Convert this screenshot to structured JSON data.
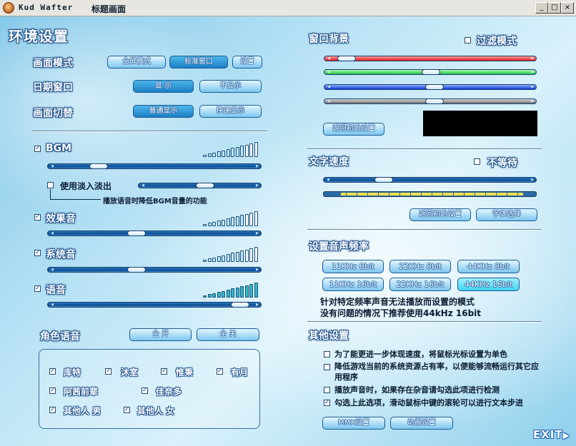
{
  "window": {
    "app_name": "Kud Wafter",
    "title": "标题画面",
    "controls": [
      "_",
      "□",
      "×"
    ]
  },
  "screen_title": "环境设置",
  "left": {
    "display_mode": {
      "label": "画面模式",
      "buttons": [
        "全屏模式",
        "标准窗口",
        "设置"
      ],
      "active": "标准窗口"
    },
    "date_window": {
      "label": "日期窗口",
      "buttons": [
        "显 示",
        "不显示"
      ],
      "active": "显 示"
    },
    "screen_switch": {
      "label": "画面切替",
      "buttons": [
        "普通显示",
        "快速显示"
      ],
      "active": "普通显示"
    },
    "bgm": {
      "label": "BGM",
      "checked": true,
      "level": 0.2,
      "volume_level": 0.75
    },
    "fade": {
      "label": "使用淡入淡出",
      "checked": false,
      "level": 0.55,
      "note": "播放语音时降低BGM音量的功能"
    },
    "sfx": {
      "label": "效果音",
      "checked": true,
      "level": 0.4,
      "volume_level": 0.75
    },
    "system": {
      "label": "系统音",
      "checked": true,
      "level": 0.4,
      "volume_level": 0.75
    },
    "voice": {
      "label": "语音",
      "checked": true,
      "level": 0.95,
      "volume_level": 1.0
    },
    "character_voice": {
      "label": "角色语音",
      "buttons": [
        "全 开",
        "全 关"
      ],
      "characters": [
        "库特",
        "沐室",
        "惟秉",
        "有月",
        "阿茜前辈",
        "佳奈多",
        "其他人 男",
        "其他人 女"
      ]
    }
  },
  "right": {
    "window_bg": {
      "label": "窗口背景",
      "filter_mode": {
        "label": "过滤模式",
        "checked": false
      },
      "sliders": [
        {
          "name": "red",
          "level": 0.05
        },
        {
          "name": "green",
          "level": 0.5
        },
        {
          "name": "blue",
          "level": 0.52
        },
        {
          "name": "alpha",
          "level": 0.52
        }
      ],
      "reset": "返回初始设置",
      "preview_color": "#000000"
    },
    "text_speed": {
      "label": "文字速度",
      "no_wait": {
        "label": "不等待",
        "checked": false
      },
      "level": 0.25,
      "reset": "返回初始设置",
      "font": "字体选择"
    },
    "sound_freq": {
      "label": "设置音声频率",
      "options": [
        "11KHz 8bit",
        "22KHz 8bit",
        "44KHz 8bit",
        "11KHz 16bit",
        "22KHz 16bit",
        "44KHz 16bit"
      ],
      "selected": "44KHz 16bit",
      "note_1": "针对特定频率声音无法播放而设置的模式",
      "note_2": "没有问题的情况下推荐使用44kHz 16bit"
    },
    "other": {
      "label": "其他设置",
      "options": [
        {
          "text": "为了能更进一步体现速度，将鼠标光标设置为单色",
          "checked": false
        },
        {
          "text": "降低游戏当前的系统资源占有率，以便能够流畅运行其它应用程序",
          "checked": false
        },
        {
          "text": "播放声音时，如果存在杂音请勾选此项进行检测",
          "checked": false
        },
        {
          "text": "勾选上此选项，滑动鼠标中键的滚轮可以进行文本步进",
          "checked": true
        }
      ],
      "buttons": [
        "MMX设置",
        "动画设置"
      ]
    }
  },
  "exit": "EXIT"
}
